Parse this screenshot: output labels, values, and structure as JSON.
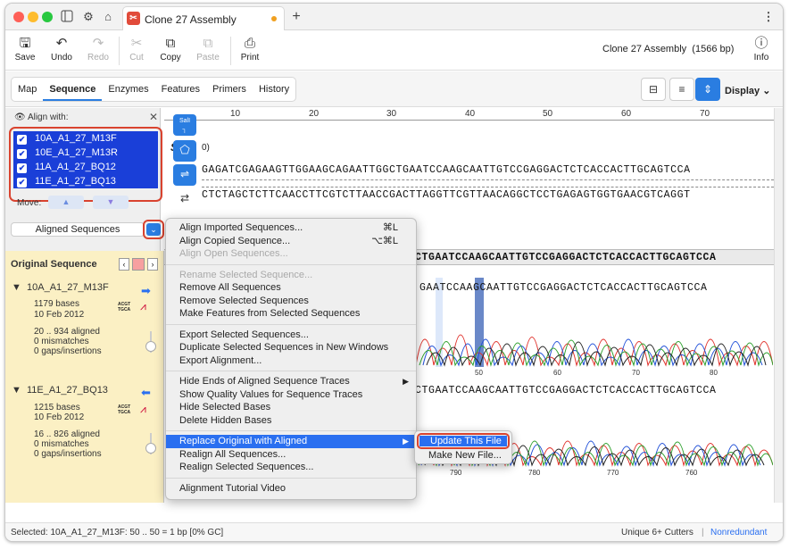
{
  "window": {
    "tab_title": "Clone 27 Assembly",
    "file_info": "Clone 27 Assembly",
    "bp": "(1566 bp)"
  },
  "toolbar": {
    "save": "Save",
    "undo": "Undo",
    "redo": "Redo",
    "cut": "Cut",
    "copy": "Copy",
    "paste": "Paste",
    "print": "Print",
    "info": "Info"
  },
  "tabs": [
    "Map",
    "Sequence",
    "Enzymes",
    "Features",
    "Primers",
    "History"
  ],
  "display_label": "Display",
  "align_panel": {
    "title": "Align with:",
    "items": [
      "10A_A1_27_M13F",
      "10E_A1_27_M13R",
      "11A_A1_27_BQ12",
      "11E_A1_27_BQ13"
    ],
    "move_label": "Move:",
    "dropdown": "Aligned Sequences"
  },
  "original": {
    "title": "Original Sequence",
    "traces": [
      {
        "name": "10A_A1_27_M13F",
        "bases": "1179 bases",
        "date": "10 Feb 2012",
        "aligned": "20 .. 934 aligned",
        "mismatches": "0 mismatches",
        "gaps": "0 gaps/insertions",
        "dir": "right"
      },
      {
        "name": "11E_A1_27_BQ13",
        "bases": "1215 bases",
        "date": "10 Feb 2012",
        "aligned": "16 .. 826 aligned",
        "mismatches": "0 mismatches",
        "gaps": "0 gaps/insertions",
        "dir": "left"
      }
    ]
  },
  "seq": {
    "ruler": [
      "10",
      "20",
      "30",
      "40",
      "50",
      "60",
      "70"
    ],
    "top_strand": "GAGATCGAGAAGTTGGAAGCAGAATTGGCTGAATCCAAGCAATTGTCCGAGGACTCTCACCACTTGCAGTCCA",
    "bottom_strand": "CTCTAGCTCTTCAACCTTCGTCTTAACCGACTTAGGTTCGTTAACAGGCTCCTGAGAGTGGTGAACGTCAGGT",
    "consensus": "CTGAATCCAAGCAATTGTCCGAGGACTCTCACCACTTGCAGTCCA",
    "trace1": "GAATCCAAGCAATTGTCCGAGGACTCTCACCACTTGCAGTCCA",
    "trace2": "CTGAATCCAAGCAATTGTCCGAGGACTCTCACCACTTGCAGTCCA",
    "ticks1": [
      "50",
      "60",
      "70",
      "80"
    ],
    "ticks2": [
      "790",
      "780",
      "770",
      "760"
    ],
    "frag_s": "S",
    "frag_0": "0)",
    "sall": "SalI"
  },
  "context_menu": {
    "groups": [
      [
        {
          "label": "Align Imported Sequences...",
          "shortcut": "⌘L"
        },
        {
          "label": "Align Copied Sequence...",
          "shortcut": "⌥⌘L"
        },
        {
          "label": "Align Open Sequences...",
          "disabled": true
        }
      ],
      [
        {
          "label": "Rename Selected Sequence...",
          "disabled": true
        },
        {
          "label": "Remove All Sequences"
        },
        {
          "label": "Remove Selected Sequences"
        },
        {
          "label": "Make Features from Selected Sequences"
        }
      ],
      [
        {
          "label": "Export Selected Sequences..."
        },
        {
          "label": "Duplicate Selected Sequences in New Windows"
        },
        {
          "label": "Export Alignment..."
        }
      ],
      [
        {
          "label": "Hide Ends of Aligned Sequence Traces",
          "submenu": true
        },
        {
          "label": "Show Quality Values for Sequence Traces"
        },
        {
          "label": "Hide Selected Bases"
        },
        {
          "label": "Delete Hidden Bases"
        }
      ],
      [
        {
          "label": "Replace Original with Aligned",
          "submenu": true,
          "highlight": true
        },
        {
          "label": "Realign All Sequences..."
        },
        {
          "label": "Realign Selected Sequences..."
        }
      ],
      [
        {
          "label": "Alignment Tutorial Video"
        }
      ]
    ]
  },
  "submenu": {
    "update": "Update This File",
    "make_new": "Make New File..."
  },
  "status": {
    "selected": "Selected:  10A_A1_27_M13F:  50 .. 50   =  1 bp     [0% GC]",
    "cutters": "Unique 6+ Cutters",
    "nonredundant": "Nonredundant"
  },
  "colors": {
    "accent": "#2a7de1",
    "selection": "#1a3fd8",
    "callout": "#d9432f",
    "trace_a": "#2ca02c",
    "trace_c": "#1f4fd8",
    "trace_g": "#222222",
    "trace_t": "#e0302a"
  }
}
